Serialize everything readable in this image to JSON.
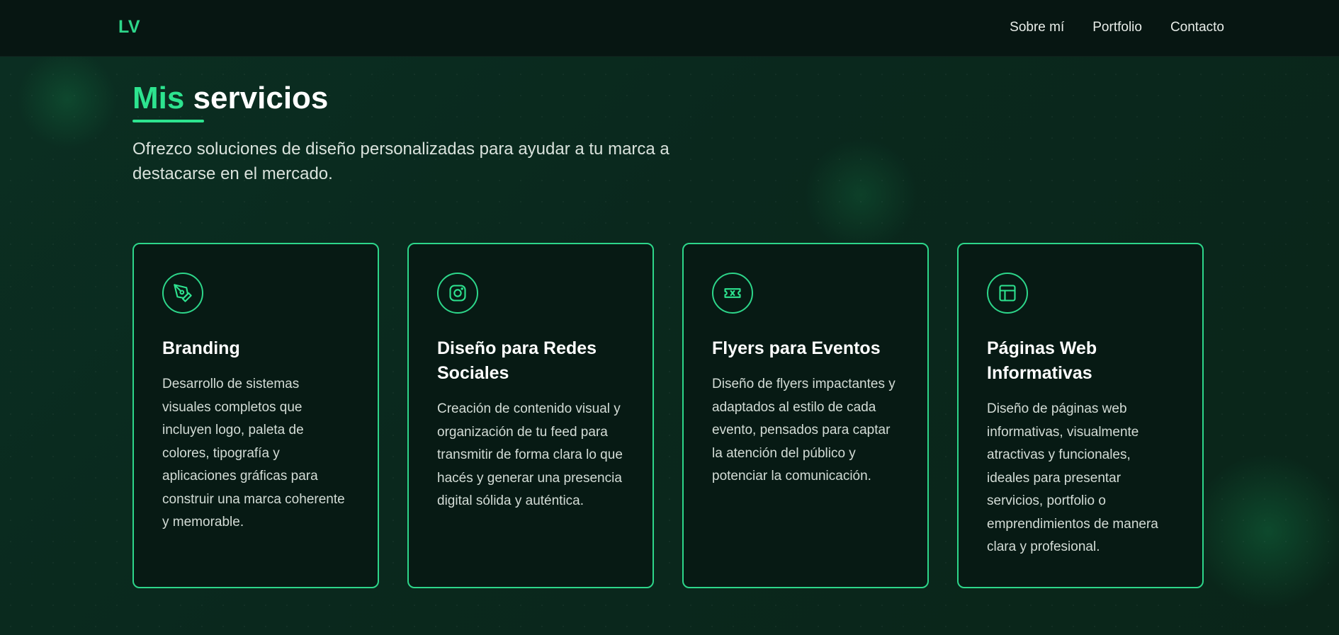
{
  "header": {
    "logo": "LV",
    "nav": [
      {
        "label": "Sobre mí"
      },
      {
        "label": "Portfolio"
      },
      {
        "label": "Contacto"
      }
    ]
  },
  "section": {
    "title_accent": "Mis",
    "title_rest": " servicios",
    "subtitle": "Ofrezco soluciones de diseño personalizadas para ayudar a tu marca a destacarse en el mercado."
  },
  "cards": [
    {
      "icon": "pen-tool-icon",
      "title": "Branding",
      "description": "Desarrollo de sistemas visuales completos que incluyen logo, paleta de colores, tipografía y aplicaciones gráficas para construir una marca coherente y memorable."
    },
    {
      "icon": "instagram-icon",
      "title": "Diseño para Redes Sociales",
      "description": "Creación de contenido visual y organización de tu feed para transmitir de forma clara lo que hacés y generar una presencia digital sólida y auténtica."
    },
    {
      "icon": "ticket-icon",
      "title": "Flyers para Eventos",
      "description": "Diseño de flyers impactantes y adaptados al estilo de cada evento, pensados para captar la atención del público y potenciar la comunicación."
    },
    {
      "icon": "layout-icon",
      "title": "Páginas Web Informativas",
      "description": "Diseño de páginas web informativas, visualmente atractivas y funcionales, ideales para presentar servicios, portfolio o emprendimientos de manera clara y profesional."
    }
  ],
  "colors": {
    "accent": "#2de38f",
    "border": "#2dd68a",
    "background": "#0a2a1f",
    "header": "#071612",
    "card": "#071a14"
  }
}
